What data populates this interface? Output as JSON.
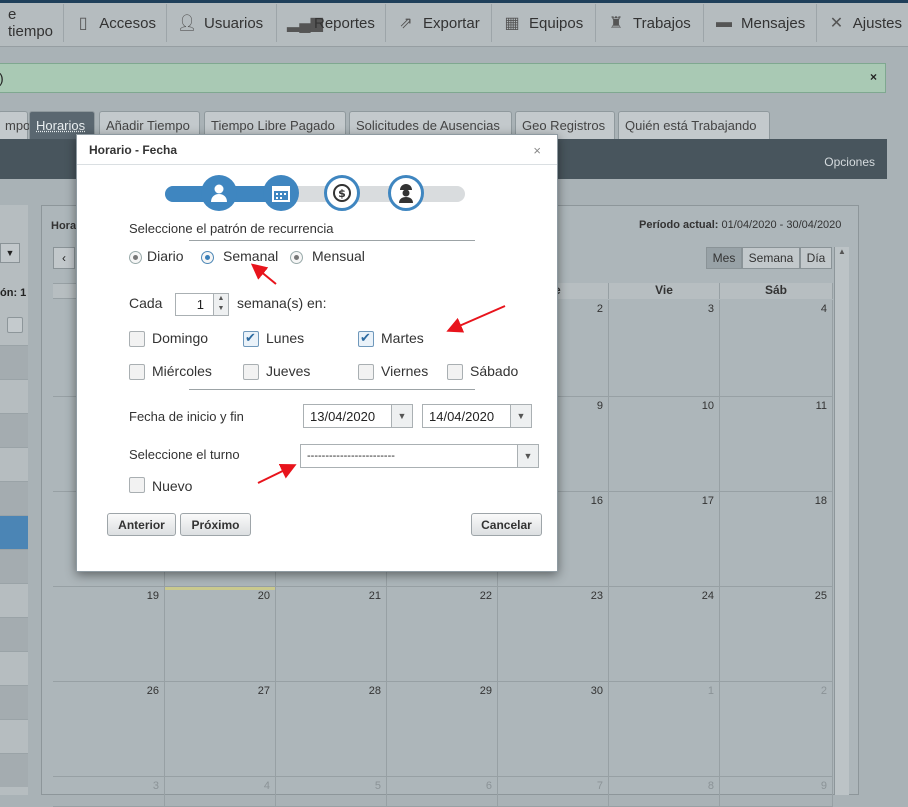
{
  "nav": {
    "items": [
      {
        "label": "e tiempo",
        "icon": ""
      },
      {
        "label": "Accesos",
        "icon": "door-icon"
      },
      {
        "label": "Usuarios",
        "icon": "user-icon"
      },
      {
        "label": "Reportes",
        "icon": "bar-chart-icon"
      },
      {
        "label": "Exportar",
        "icon": "export-icon"
      },
      {
        "label": "Equipos",
        "icon": "team-icon"
      },
      {
        "label": "Trabajos",
        "icon": "workers-icon"
      },
      {
        "label": "Mensajes",
        "icon": "message-icon"
      },
      {
        "label": "Ajustes",
        "icon": "tools-icon"
      }
    ]
  },
  "alert": {
    "text": ")",
    "close": "×"
  },
  "tabs": [
    {
      "label": "mpo"
    },
    {
      "label": "Horarios"
    },
    {
      "label": "Añadir Tiempo"
    },
    {
      "label": "Tiempo Libre Pagado"
    },
    {
      "label": "Solicitudes de Ausencias"
    },
    {
      "label": "Geo Registros"
    },
    {
      "label": "Quién está Trabajando"
    }
  ],
  "toolbar": {
    "options": "Opciones"
  },
  "left": {
    "header": "ón: 1"
  },
  "calendar": {
    "title_partial": "Hora",
    "period_label": "Período actual:",
    "period_value": "01/04/2020 - 30/04/2020",
    "views": [
      "Mes",
      "Semana",
      "Día"
    ],
    "active_view": "Mes",
    "day_headers": [
      "e",
      "Vie",
      "Sáb"
    ],
    "weeks": [
      [
        "",
        "",
        "",
        "",
        "2",
        "3",
        "4"
      ],
      [
        "",
        "",
        "",
        "",
        "9",
        "10",
        "11"
      ],
      [
        "",
        "",
        "",
        "",
        "16",
        "17",
        "18"
      ],
      [
        "19",
        "20",
        "21",
        "22",
        "23",
        "24",
        "25"
      ],
      [
        "26",
        "27",
        "28",
        "29",
        "30",
        "1",
        "2"
      ],
      [
        "3",
        "4",
        "5",
        "6",
        "7",
        "8",
        "9"
      ]
    ]
  },
  "modal": {
    "title": "Horario - Fecha",
    "close": "×",
    "steps": [
      "user-icon",
      "calendar-icon",
      "money-cycle-icon",
      "worker-icon"
    ],
    "pattern_label": "Seleccione el patrón de recurrencia",
    "patterns": [
      "Diario",
      "Semanal",
      "Mensual"
    ],
    "selected_pattern": "Semanal",
    "every_label": "Cada",
    "every_value": "1",
    "every_suffix": "semana(s) en:",
    "days": [
      {
        "label": "Domingo",
        "checked": false
      },
      {
        "label": "Lunes",
        "checked": true
      },
      {
        "label": "Martes",
        "checked": true
      },
      {
        "label": "Miércoles",
        "checked": false
      },
      {
        "label": "Jueves",
        "checked": false
      },
      {
        "label": "Viernes",
        "checked": false
      },
      {
        "label": "Sábado",
        "checked": false
      }
    ],
    "dates_label": "Fecha de inicio y fin",
    "start_date": "13/04/2020",
    "end_date": "14/04/2020",
    "shift_label": "Seleccione el turno",
    "shift_value": "------------------------",
    "new_label": "Nuevo",
    "buttons": {
      "prev": "Anterior",
      "next": "Próximo",
      "cancel": "Cancelar"
    }
  },
  "colors": {
    "accent": "#3a7fb8",
    "annotation_arrow": "#e8141c",
    "alert_bg": "#a9c9b4"
  }
}
